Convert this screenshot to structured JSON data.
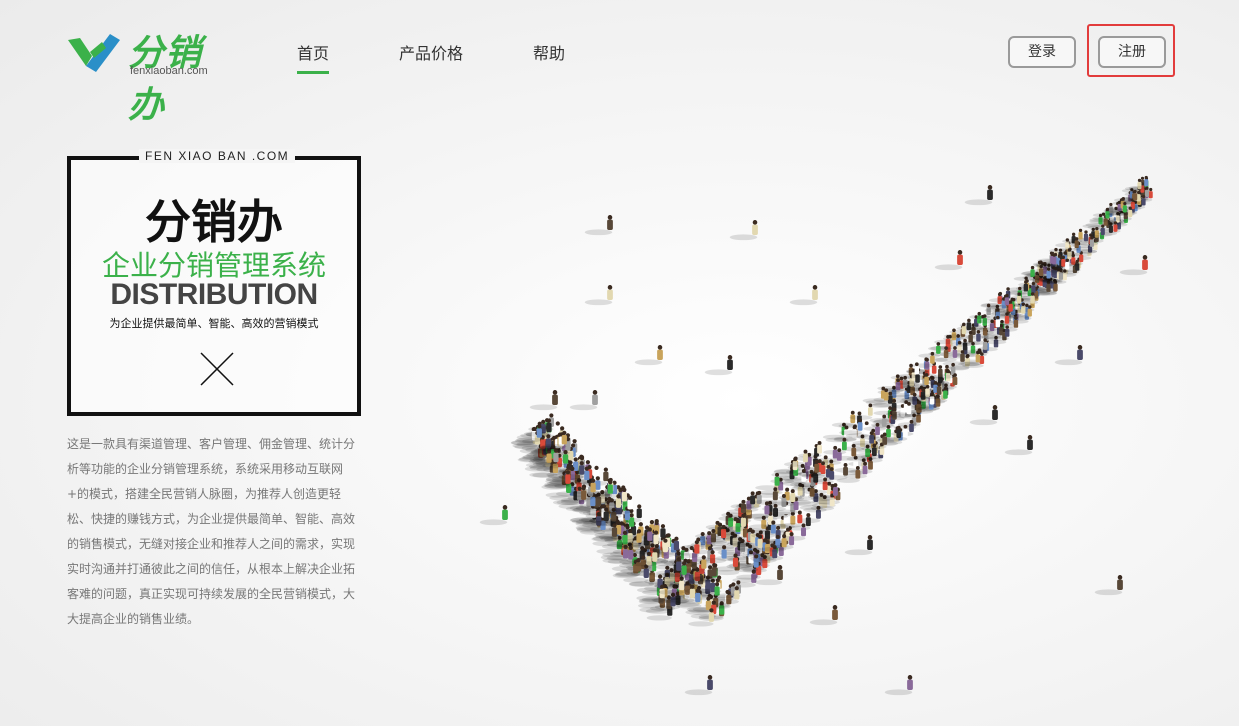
{
  "brand": {
    "name_cn": "分销办",
    "domain": "fenxiaoban.com"
  },
  "nav": {
    "items": [
      {
        "label": "首页",
        "active": true
      },
      {
        "label": "产品价格",
        "active": false
      },
      {
        "label": "帮助",
        "active": false
      }
    ]
  },
  "auth": {
    "login_label": "登录",
    "register_label": "注册"
  },
  "hero": {
    "top_label": "FEN XIAO BAN .COM",
    "title": "分销办",
    "subtitle": "企业分销管理系统",
    "english": "DISTRIBUTION",
    "slogan": "为企业提供最简单、智能、高效的营销模式"
  },
  "description": [
    "这是一款具有渠道管理、客户管理、佣金管理、统计分",
    "析等功能的企业分销管理系统，系统采用移动互联网",
    "+的模式，搭建全民营销人脉圈，为推荐人创造更轻",
    "松、快捷的赚钱方式，为企业提供最简单、智能、高效",
    "的销售模式，无缝对接企业和推荐人之间的需求，实现",
    "实时沟通并打通彼此之间的信任，从根本上解决企业拓",
    "客难的问题，真正实现可持续发展的全民营销模式，大",
    "大提高企业的销售业绩。"
  ],
  "colors": {
    "accent": "#3bb14a",
    "highlight": "#e23c3c"
  }
}
